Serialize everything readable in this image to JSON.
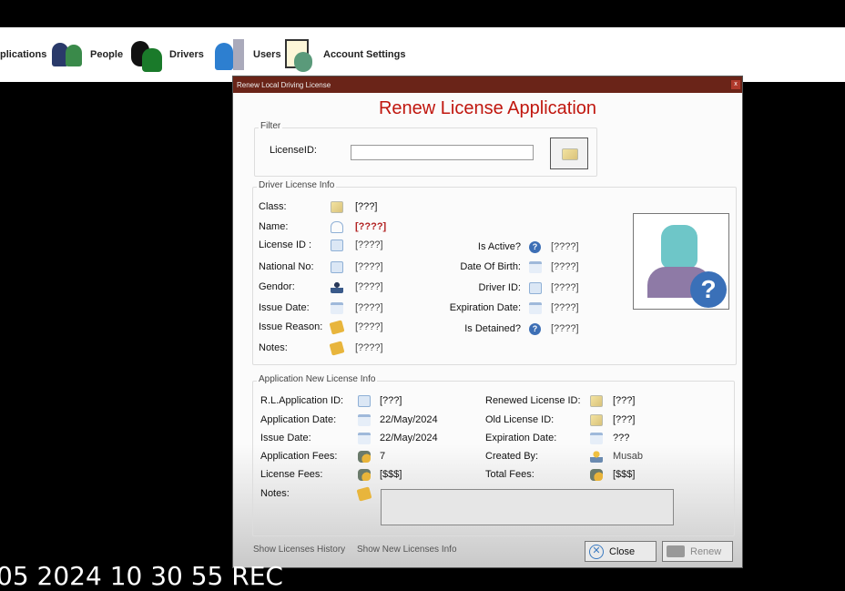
{
  "toolbar": {
    "items": [
      {
        "label": "plications",
        "icon": "applications-icon"
      },
      {
        "label": "People",
        "icon": "people-icon"
      },
      {
        "label": "Drivers",
        "icon": "drivers-icon"
      },
      {
        "label": "Users",
        "icon": "users-icon"
      },
      {
        "label": "Account Settings",
        "icon": "account-settings-icon"
      }
    ]
  },
  "dialog": {
    "window_title": "Renew Local Driving License",
    "close_glyph": "x",
    "heading": "Renew License Application",
    "filter": {
      "legend": "Filter",
      "license_id_label": "LicenseID:",
      "license_id_value": ""
    },
    "driver_info": {
      "legend": "Driver License Info",
      "class": {
        "label": "Class:",
        "value": "[???]"
      },
      "name": {
        "label": "Name:",
        "value": "[????]"
      },
      "license_id": {
        "label": "License ID :",
        "value": "[????]"
      },
      "national_no": {
        "label": "National No:",
        "value": "[????]"
      },
      "gender": {
        "label": "Gendor:",
        "value": "[????]"
      },
      "issue_date": {
        "label": "Issue Date:",
        "value": "[????]"
      },
      "issue_reason": {
        "label": "Issue Reason:",
        "value": "[????]"
      },
      "notes": {
        "label": "Notes:",
        "value": "[????]"
      },
      "is_active": {
        "label": "Is Active?",
        "value": "[????]"
      },
      "date_of_birth": {
        "label": "Date Of Birth:",
        "value": "[????]"
      },
      "driver_id": {
        "label": "Driver ID:",
        "value": "[????]"
      },
      "expiration_date": {
        "label": "Expiration Date:",
        "value": "[????]"
      },
      "is_detained": {
        "label": "Is Detained?",
        "value": "[????]"
      }
    },
    "app_info": {
      "legend": "Application New License Info",
      "rl_app_id": {
        "label": "R.L.Application ID:",
        "value": "[???]"
      },
      "application_date": {
        "label": "Application Date:",
        "value": "22/May/2024"
      },
      "issue_date": {
        "label": "Issue Date:",
        "value": "22/May/2024"
      },
      "application_fees": {
        "label": "Application Fees:",
        "value": "7"
      },
      "license_fees": {
        "label": "License  Fees:",
        "value": "[$$$]"
      },
      "notes": {
        "label": "Notes:",
        "value": ""
      },
      "renewed_license_id": {
        "label": "Renewed License ID:",
        "value": "[???]"
      },
      "old_license_id": {
        "label": "Old License ID:",
        "value": "[???]"
      },
      "expiration_date": {
        "label": "Expiration Date:",
        "value": "???"
      },
      "created_by": {
        "label": "Created By:",
        "value": "Musab"
      },
      "total_fees": {
        "label": "Total  Fees:",
        "value": "[$$$]"
      }
    },
    "links": {
      "history": "Show Licenses History",
      "new_info": "Show New Licenses Info"
    },
    "buttons": {
      "close": "Close",
      "renew": "Renew"
    }
  },
  "recording_overlay": "05 2024 10 30 55 REC",
  "colors": {
    "title_bar": "#6a2418",
    "heading": "#c0160e",
    "name_value": "#b22222"
  }
}
